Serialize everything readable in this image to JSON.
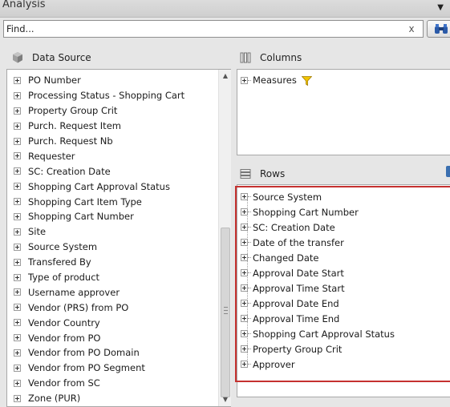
{
  "window": {
    "title": "Analysis"
  },
  "search": {
    "value": "Find...",
    "clear_label": "x"
  },
  "data_source": {
    "title": "Data Source",
    "items": [
      "PO Number",
      "Processing Status - Shopping Cart",
      "Property Group Crit",
      "Purch. Request Item",
      "Purch. Request Nb",
      "Requester",
      "SC: Creation Date",
      "Shopping Cart Approval Status",
      "Shopping Cart Item Type",
      "Shopping Cart Number",
      "Site",
      "Source System",
      "Transfered By",
      "Type of product",
      "Username approver",
      "Vendor (PRS) from PO",
      "Vendor Country",
      "Vendor from PO",
      "Vendor from PO Domain",
      "Vendor from PO Segment",
      "Vendor from SC",
      "Zone (PUR)"
    ]
  },
  "columns": {
    "title": "Columns",
    "items": [
      "Measures"
    ]
  },
  "rows": {
    "title": "Rows",
    "items": [
      "Source System",
      "Shopping Cart Number",
      "SC: Creation Date",
      "Date of the transfer",
      "Changed Date",
      "Approval Date Start",
      "Approval Time Start",
      "Approval Date End",
      "Approval Time End",
      "Shopping Cart Approval Status",
      "Property Group Crit",
      "Approver"
    ]
  },
  "colors": {
    "highlight_border": "#c5312f",
    "filter_icon": "#f2c500",
    "panel_background": "#ffffff",
    "window_background": "#e6e6e6"
  },
  "icons": {
    "data_source": "cube-icon",
    "columns": "columns-icon",
    "rows": "rows-icon",
    "search": "binoculars-icon",
    "filter": "funnel-icon"
  }
}
